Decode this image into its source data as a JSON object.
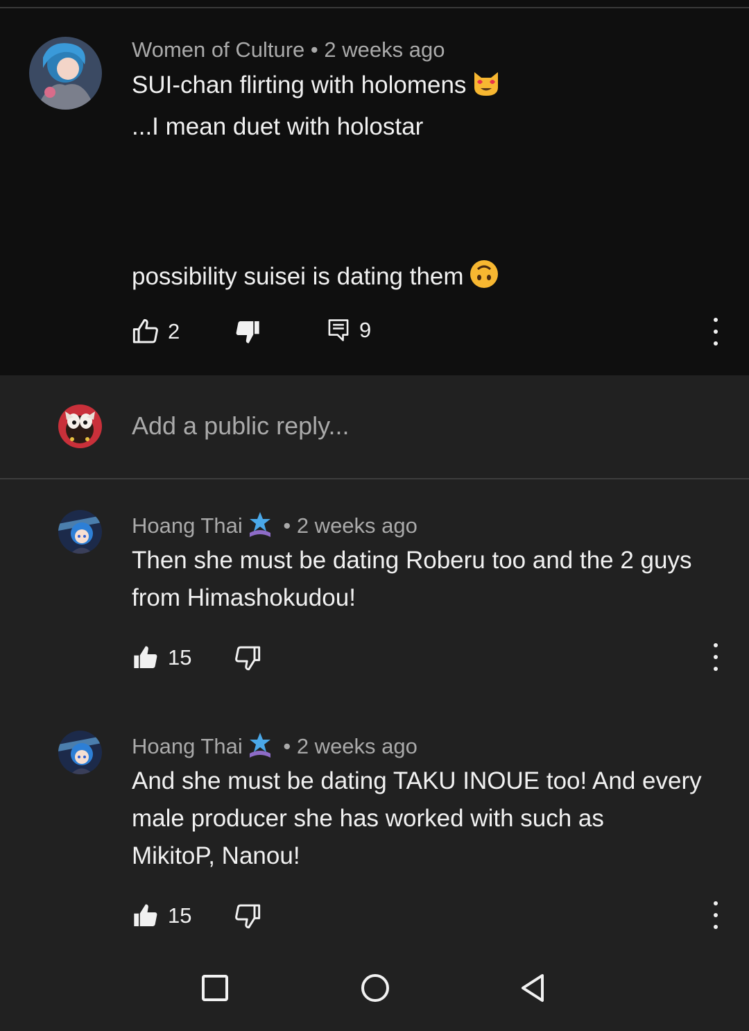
{
  "main_comment": {
    "author": "Women of Culture",
    "time": "2 weeks ago",
    "line1": "SUI-chan flirting with holomens",
    "line1_emoji": "smiling-cat-heart-eyes-emoji",
    "line2": "...I mean duet with holostar",
    "line3": "possibility suisei is dating them",
    "line3_emoji": "upside-down-face-emoji",
    "likes": "2",
    "replies": "9"
  },
  "reply_box": {
    "placeholder": "Add a public reply..."
  },
  "replies": [
    {
      "author": "Hoang Thai",
      "time": "2 weeks ago",
      "line1": "Then she must be dating Roberu too and the 2 guys",
      "line2": "from Himashokudou!",
      "likes": "15"
    },
    {
      "author": "Hoang Thai",
      "time": "2 weeks ago",
      "line1": "And she must be dating TAKU INOUE too! And every",
      "line2": "male producer she has worked with such as",
      "line3": "MikitoP, Nanou!",
      "likes": "15"
    }
  ],
  "separator": "•",
  "colors": {
    "background": "#212121",
    "comment_background": "#0f0f0f",
    "meta_text": "#aaaaaa",
    "text": "#f1f1f1",
    "badge_blue": "#4aa8e8",
    "badge_purple": "#8e6cc8"
  },
  "navbar": {
    "recents_icon": "square-icon",
    "home_icon": "circle-icon",
    "back_icon": "triangle-back-icon"
  }
}
